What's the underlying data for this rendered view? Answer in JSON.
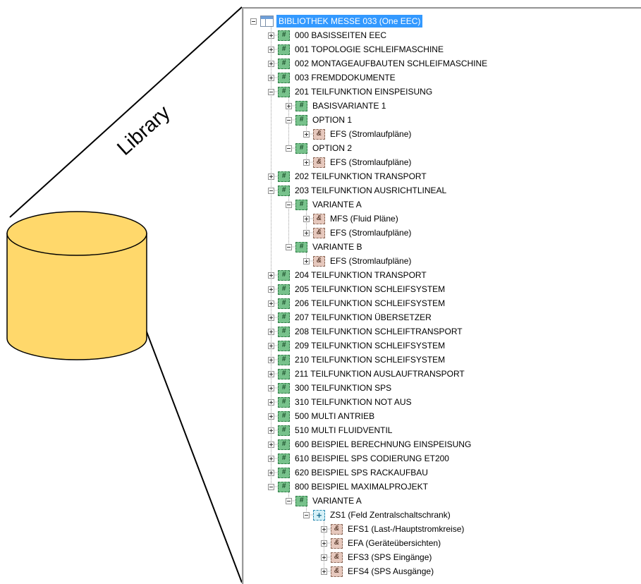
{
  "library_label": "Library",
  "colors": {
    "cylinder_fill": "#ffd86b",
    "cylinder_stroke": "#000000",
    "selection": "#3399ff",
    "group_icon": "#78c28c",
    "document_icon": "#e6c8bd",
    "location_icon": "#d5f0f7"
  },
  "tree": {
    "nodes": [
      {
        "level": 0,
        "expander": "minus",
        "icon": "library-icon",
        "label": "BIBLIOTHEK MESSE 033 (One EEC)",
        "selected": true
      },
      {
        "level": 1,
        "expander": "plus",
        "icon": "hash-icon",
        "label": "000 BASISSEITEN EEC"
      },
      {
        "level": 1,
        "expander": "plus",
        "icon": "hash-icon",
        "label": "001 TOPOLOGIE SCHLEIFMASCHINE"
      },
      {
        "level": 1,
        "expander": "plus",
        "icon": "hash-icon",
        "label": "002 MONTAGEAUFBAUTEN SCHLEIFMASCHINE"
      },
      {
        "level": 1,
        "expander": "plus",
        "icon": "hash-icon",
        "label": "003 FREMDDOKUMENTE"
      },
      {
        "level": 1,
        "expander": "minus",
        "icon": "hash-icon",
        "label": "201 TEILFUNKTION EINSPEISUNG"
      },
      {
        "level": 2,
        "expander": "plus",
        "icon": "hash-icon",
        "label": "BASISVARIANTE 1"
      },
      {
        "level": 2,
        "expander": "minus",
        "icon": "hash-icon",
        "label": "OPTION 1"
      },
      {
        "level": 3,
        "expander": "plus",
        "icon": "ampersand-icon",
        "label": "EFS (Stromlaufpläne)"
      },
      {
        "level": 2,
        "expander": "minus",
        "icon": "hash-icon",
        "label": "OPTION 2"
      },
      {
        "level": 3,
        "expander": "plus",
        "icon": "ampersand-icon",
        "label": "EFS (Stromlaufpläne)"
      },
      {
        "level": 1,
        "expander": "plus",
        "icon": "hash-icon",
        "label": "202 TEILFUNKTION TRANSPORT"
      },
      {
        "level": 1,
        "expander": "minus",
        "icon": "hash-icon",
        "label": "203 TEILFUNKTION AUSRICHTLINEAL"
      },
      {
        "level": 2,
        "expander": "minus",
        "icon": "hash-icon",
        "label": "VARIANTE A"
      },
      {
        "level": 3,
        "expander": "plus",
        "icon": "ampersand-icon",
        "label": "MFS (Fluid Pläne)"
      },
      {
        "level": 3,
        "expander": "plus",
        "icon": "ampersand-icon",
        "label": "EFS (Stromlaufpläne)"
      },
      {
        "level": 2,
        "expander": "minus",
        "icon": "hash-icon",
        "label": "VARIANTE B"
      },
      {
        "level": 3,
        "expander": "plus",
        "icon": "ampersand-icon",
        "label": "EFS (Stromlaufpläne)"
      },
      {
        "level": 1,
        "expander": "plus",
        "icon": "hash-icon",
        "label": "204 TEILFUNKTION TRANSPORT"
      },
      {
        "level": 1,
        "expander": "plus",
        "icon": "hash-icon",
        "label": "205 TEILFUNKTION SCHLEIFSYSTEM"
      },
      {
        "level": 1,
        "expander": "plus",
        "icon": "hash-icon",
        "label": "206 TEILFUNKTION SCHLEIFSYSTEM"
      },
      {
        "level": 1,
        "expander": "plus",
        "icon": "hash-icon",
        "label": "207 TEILFUNKTION ÜBERSETZER"
      },
      {
        "level": 1,
        "expander": "plus",
        "icon": "hash-icon",
        "label": "208 TEILFUNKTION SCHLEIFTRANSPORT"
      },
      {
        "level": 1,
        "expander": "plus",
        "icon": "hash-icon",
        "label": "209 TEILFUNKTION SCHLEIFSYSTEM"
      },
      {
        "level": 1,
        "expander": "plus",
        "icon": "hash-icon",
        "label": "210 TEILFUNKTION SCHLEIFSYSTEM"
      },
      {
        "level": 1,
        "expander": "plus",
        "icon": "hash-icon",
        "label": "211 TEILFUNKTION AUSLAUFTRANSPORT"
      },
      {
        "level": 1,
        "expander": "plus",
        "icon": "hash-icon",
        "label": "300 TEILFUNKTION SPS"
      },
      {
        "level": 1,
        "expander": "plus",
        "icon": "hash-icon",
        "label": "310 TEILFUNKTION NOT AUS"
      },
      {
        "level": 1,
        "expander": "plus",
        "icon": "hash-icon",
        "label": "500 MULTI ANTRIEB"
      },
      {
        "level": 1,
        "expander": "plus",
        "icon": "hash-icon",
        "label": "510 MULTI FLUIDVENTIL"
      },
      {
        "level": 1,
        "expander": "plus",
        "icon": "hash-icon",
        "label": "600 BEISPIEL BERECHNUNG EINSPEISUNG"
      },
      {
        "level": 1,
        "expander": "plus",
        "icon": "hash-icon",
        "label": "610 BEISPIEL SPS CODIERUNG ET200"
      },
      {
        "level": 1,
        "expander": "plus",
        "icon": "hash-icon",
        "label": "620 BEISPIEL SPS RACKAUFBAU"
      },
      {
        "level": 1,
        "expander": "minus",
        "icon": "hash-icon",
        "label": "800 BEISPIEL MAXIMALPROJEKT"
      },
      {
        "level": 2,
        "expander": "minus",
        "icon": "hash-icon",
        "label": "VARIANTE A"
      },
      {
        "level": 3,
        "expander": "minus",
        "icon": "plus-box-icon",
        "label": "ZS1 (Feld Zentralschaltschrank)"
      },
      {
        "level": 4,
        "expander": "plus",
        "icon": "ampersand-icon",
        "label": "EFS1 (Last-/Hauptstromkreise)"
      },
      {
        "level": 4,
        "expander": "plus",
        "icon": "ampersand-icon",
        "label": "EFA (Geräteübersichten)"
      },
      {
        "level": 4,
        "expander": "plus",
        "icon": "ampersand-icon",
        "label": "EFS3 (SPS Eingänge)"
      },
      {
        "level": 4,
        "expander": "plus",
        "icon": "ampersand-icon",
        "label": "EFS4 (SPS Ausgänge)"
      }
    ]
  }
}
